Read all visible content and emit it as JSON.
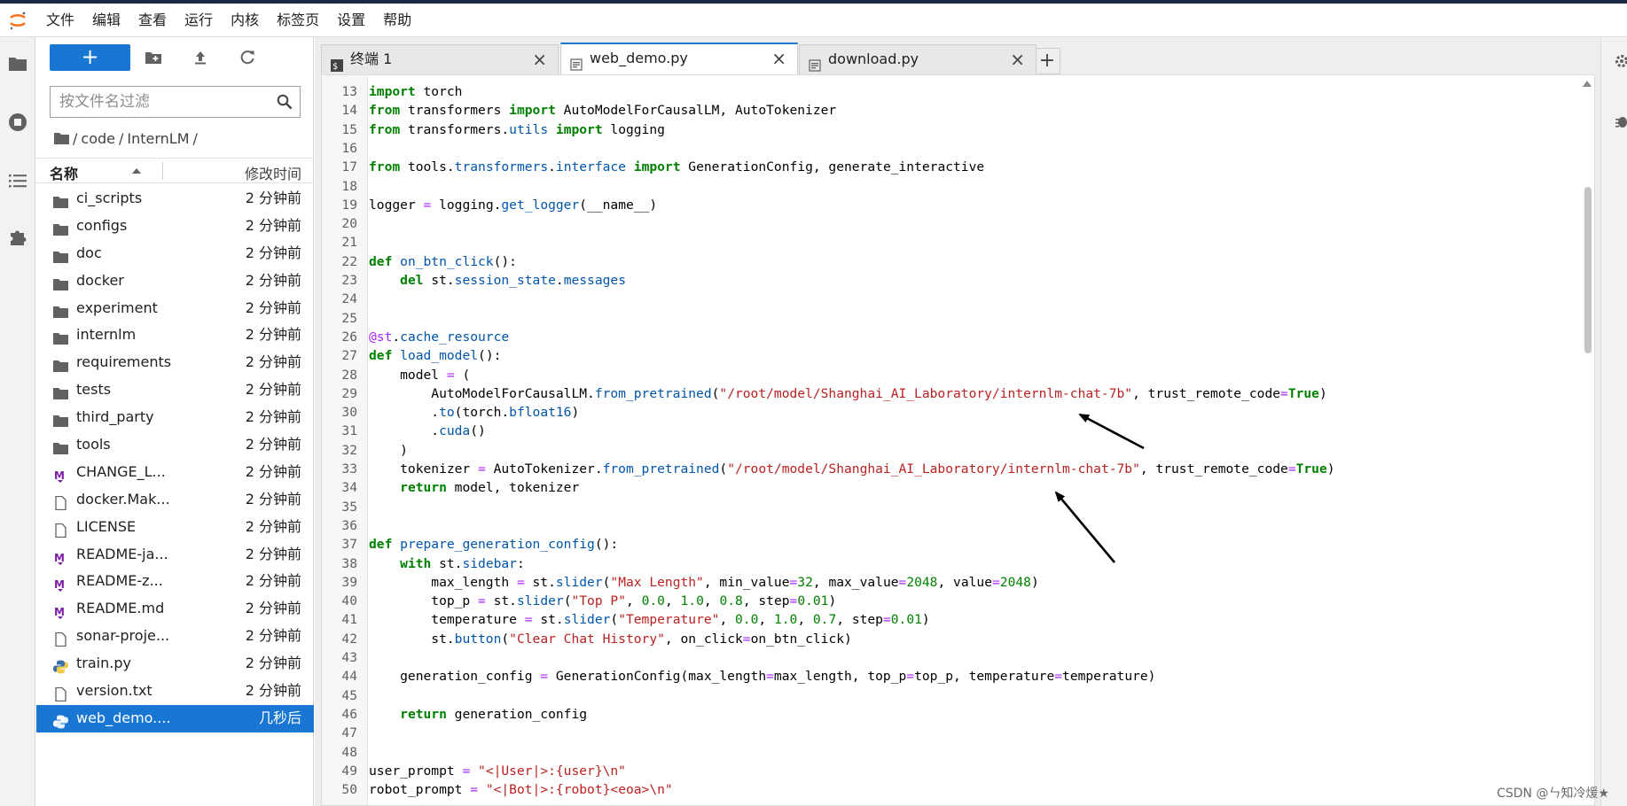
{
  "menu": [
    "文件",
    "编辑",
    "查看",
    "运行",
    "内核",
    "标签页",
    "设置",
    "帮助"
  ],
  "filebrowser": {
    "new_label": "+",
    "filter_placeholder": "按文件名过滤",
    "breadcrumb": [
      "/",
      "code",
      "/",
      "InternLM",
      "/"
    ],
    "col_name": "名称",
    "col_modified": "修改时间",
    "items": [
      {
        "name": "ci_scripts",
        "time": "2 分钟前",
        "icon": "folder-icon"
      },
      {
        "name": "configs",
        "time": "2 分钟前",
        "icon": "folder-icon"
      },
      {
        "name": "doc",
        "time": "2 分钟前",
        "icon": "folder-icon"
      },
      {
        "name": "docker",
        "time": "2 分钟前",
        "icon": "folder-icon"
      },
      {
        "name": "experiment",
        "time": "2 分钟前",
        "icon": "folder-icon"
      },
      {
        "name": "internlm",
        "time": "2 分钟前",
        "icon": "folder-icon"
      },
      {
        "name": "requirements",
        "time": "2 分钟前",
        "icon": "folder-icon"
      },
      {
        "name": "tests",
        "time": "2 分钟前",
        "icon": "folder-icon"
      },
      {
        "name": "third_party",
        "time": "2 分钟前",
        "icon": "folder-icon"
      },
      {
        "name": "tools",
        "time": "2 分钟前",
        "icon": "folder-icon"
      },
      {
        "name": "CHANGE_L...",
        "time": "2 分钟前",
        "icon": "markdown-icon"
      },
      {
        "name": "docker.Mak...",
        "time": "2 分钟前",
        "icon": "file-icon"
      },
      {
        "name": "LICENSE",
        "time": "2 分钟前",
        "icon": "file-icon"
      },
      {
        "name": "README-ja...",
        "time": "2 分钟前",
        "icon": "markdown-icon"
      },
      {
        "name": "README-z...",
        "time": "2 分钟前",
        "icon": "markdown-icon"
      },
      {
        "name": "README.md",
        "time": "2 分钟前",
        "icon": "markdown-icon"
      },
      {
        "name": "sonar-proje...",
        "time": "2 分钟前",
        "icon": "file-icon"
      },
      {
        "name": "train.py",
        "time": "2 分钟前",
        "icon": "python-icon"
      },
      {
        "name": "version.txt",
        "time": "2 分钟前",
        "icon": "file-icon"
      },
      {
        "name": "web_demo....",
        "time": "几秒后",
        "icon": "python-icon",
        "selected": true
      }
    ]
  },
  "tabs": [
    {
      "label": "终端 1",
      "icon": "terminal-icon",
      "active": false
    },
    {
      "label": "web_demo.py",
      "icon": "text-file-icon",
      "active": true
    },
    {
      "label": "download.py",
      "icon": "text-file-icon",
      "active": false
    }
  ],
  "tab_add_label": "+",
  "tab_close_label": "×",
  "code_lines": [
    {
      "n": "13",
      "t": "[[kw:import]] torch"
    },
    {
      "n": "14",
      "t": "[[kw:from]] transformers [[kw:import]] AutoModelForCausalLM, AutoTokenizer"
    },
    {
      "n": "15",
      "t": "[[kw:from]] transformers.[[fn:utils]] [[kw:import]] logging"
    },
    {
      "n": "16",
      "t": ""
    },
    {
      "n": "17",
      "t": "[[kw:from]] tools.[[fn:transformers]].[[fn:interface]] [[kw:import]] GenerationConfig, generate_interactive"
    },
    {
      "n": "18",
      "t": ""
    },
    {
      "n": "19",
      "t": "logger [[op:=]] logging.[[fn:get_logger]](__name__)"
    },
    {
      "n": "20",
      "t": ""
    },
    {
      "n": "21",
      "t": ""
    },
    {
      "n": "22",
      "t": "[[kw:def]] [[fn:on_btn_click]]():"
    },
    {
      "n": "23",
      "t": "    [[kw:del]] st.[[fn:session_state]].[[fn:messages]]"
    },
    {
      "n": "24",
      "t": ""
    },
    {
      "n": "25",
      "t": ""
    },
    {
      "n": "26",
      "t": "[[dec:@st]].[[fn:cache_resource]]"
    },
    {
      "n": "27",
      "t": "[[kw:def]] [[fn:load_model]]():"
    },
    {
      "n": "28",
      "t": "    model [[op:=]] ("
    },
    {
      "n": "29",
      "t": "        AutoModelForCausalLM.[[fn:from_pretrained]]([[str:\"/root/model/Shanghai_AI_Laboratory/internlm-chat-7b\"]], trust_remote_code[[op:=]][[kw:True]])"
    },
    {
      "n": "30",
      "t": "        .[[fn:to]](torch.[[fn:bfloat16]])"
    },
    {
      "n": "31",
      "t": "        .[[fn:cuda]]()"
    },
    {
      "n": "32",
      "t": "    )"
    },
    {
      "n": "33",
      "t": "    tokenizer [[op:=]] AutoTokenizer.[[fn:from_pretrained]]([[str:\"/root/model/Shanghai_AI_Laboratory/internlm-chat-7b\"]], trust_remote_code[[op:=]][[kw:True]])"
    },
    {
      "n": "34",
      "t": "    [[kw:return]] model, tokenizer"
    },
    {
      "n": "35",
      "t": ""
    },
    {
      "n": "36",
      "t": ""
    },
    {
      "n": "37",
      "t": "[[kw:def]] [[fn:prepare_generation_config]]():"
    },
    {
      "n": "38",
      "t": "    [[kw:with]] st.[[fn:sidebar]]:"
    },
    {
      "n": "39",
      "t": "        max_length [[op:=]] st.[[fn:slider]]([[str:\"Max Length\"]], min_value[[op:=]][[num:32]], max_value[[op:=]][[num:2048]], value[[op:=]][[num:2048]])"
    },
    {
      "n": "40",
      "t": "        top_p [[op:=]] st.[[fn:slider]]([[str:\"Top P\"]], [[num:0.0]], [[num:1.0]], [[num:0.8]], step[[op:=]][[num:0.01]])"
    },
    {
      "n": "41",
      "t": "        temperature [[op:=]] st.[[fn:slider]]([[str:\"Temperature\"]], [[num:0.0]], [[num:1.0]], [[num:0.7]], step[[op:=]][[num:0.01]])"
    },
    {
      "n": "42",
      "t": "        st.[[fn:button]]([[str:\"Clear Chat History\"]], on_click[[op:=]]on_btn_click)"
    },
    {
      "n": "43",
      "t": ""
    },
    {
      "n": "44",
      "t": "    generation_config [[op:=]] GenerationConfig(max_length[[op:=]]max_length, top_p[[op:=]]top_p, temperature[[op:=]]temperature)"
    },
    {
      "n": "45",
      "t": ""
    },
    {
      "n": "46",
      "t": "    [[kw:return]] generation_config"
    },
    {
      "n": "47",
      "t": ""
    },
    {
      "n": "48",
      "t": ""
    },
    {
      "n": "49",
      "t": "user_prompt [[op:=]] [[str:\"<|User|>:{user}\\n\"]]"
    },
    {
      "n": "50",
      "t": "robot_prompt [[op:=]] [[str:\"<|Bot|>:{robot}<eoa>\\n\"]]"
    }
  ],
  "watermark": "CSDN @ㄣ知冷煖★",
  "colors": {
    "accent": "#1976d2",
    "keyword": "#008000",
    "string": "#ba2121",
    "function": "#0055aa"
  }
}
